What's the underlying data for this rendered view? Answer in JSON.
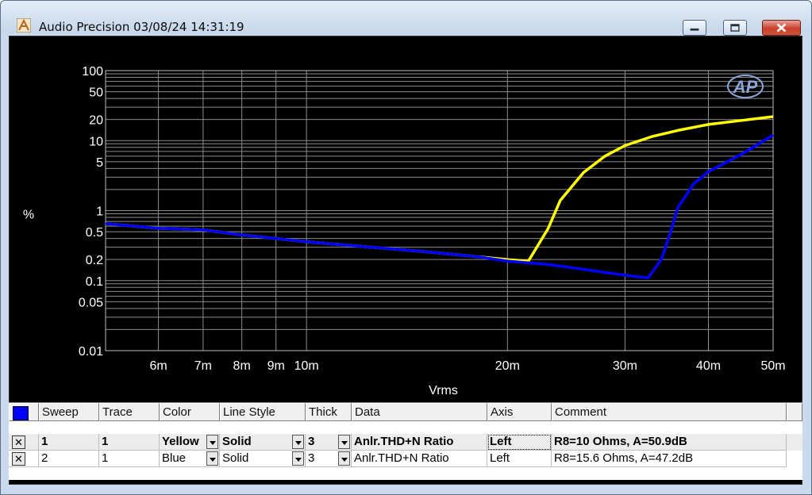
{
  "window": {
    "title": "Audio Precision  03/08/24 14:31:19",
    "app_icon": "audio-precision-icon",
    "buttons": [
      "minimize-icon",
      "maximize-icon",
      "close-icon"
    ]
  },
  "chart_data": {
    "type": "line",
    "xlabel": "Vrms",
    "ylabel": "%",
    "x_scale": "log",
    "y_scale": "log",
    "xlim": [
      0.005,
      0.05
    ],
    "ylim": [
      0.01,
      100
    ],
    "grid": true,
    "logo": "AP",
    "x_ticks": [
      {
        "label": "6m",
        "value": 0.006
      },
      {
        "label": "7m",
        "value": 0.007
      },
      {
        "label": "8m",
        "value": 0.008
      },
      {
        "label": "9m",
        "value": 0.009
      },
      {
        "label": "10m",
        "value": 0.01
      },
      {
        "label": "20m",
        "value": 0.02
      },
      {
        "label": "30m",
        "value": 0.03
      },
      {
        "label": "40m",
        "value": 0.04
      },
      {
        "label": "50m",
        "value": 0.05
      }
    ],
    "y_ticks": [
      {
        "label": "100",
        "value": 100
      },
      {
        "label": "50",
        "value": 50
      },
      {
        "label": "20",
        "value": 20
      },
      {
        "label": "10",
        "value": 10
      },
      {
        "label": "5",
        "value": 5
      },
      {
        "label": "1",
        "value": 1
      },
      {
        "label": "0.5",
        "value": 0.5
      },
      {
        "label": "0.2",
        "value": 0.2
      },
      {
        "label": "0.1",
        "value": 0.1
      },
      {
        "label": "0.05",
        "value": 0.05
      },
      {
        "label": "0.01",
        "value": 0.01
      }
    ],
    "series": [
      {
        "color": "#ffff00",
        "x": [
          0.005,
          0.006,
          0.007,
          0.008,
          0.01,
          0.012,
          0.015,
          0.018,
          0.02,
          0.0215,
          0.023,
          0.024,
          0.026,
          0.028,
          0.03,
          0.033,
          0.036,
          0.04,
          0.045,
          0.05
        ],
        "y": [
          0.65,
          0.56,
          0.53,
          0.45,
          0.36,
          0.31,
          0.26,
          0.22,
          0.2,
          0.19,
          0.55,
          1.4,
          3.5,
          6.0,
          8.5,
          11.5,
          14.0,
          17.0,
          19.5,
          22.0
        ]
      },
      {
        "color": "#0000ff",
        "x": [
          0.005,
          0.006,
          0.007,
          0.008,
          0.01,
          0.012,
          0.015,
          0.018,
          0.02,
          0.023,
          0.026,
          0.029,
          0.031,
          0.0325,
          0.034,
          0.035,
          0.036,
          0.038,
          0.04,
          0.045,
          0.05
        ],
        "y": [
          0.65,
          0.56,
          0.53,
          0.45,
          0.36,
          0.31,
          0.26,
          0.22,
          0.19,
          0.17,
          0.145,
          0.125,
          0.115,
          0.11,
          0.2,
          0.45,
          1.1,
          2.4,
          3.6,
          6.5,
          12.0
        ]
      }
    ]
  },
  "table": {
    "headers": [
      "Sweep",
      "Trace",
      "Color",
      "Line Style",
      "Thick",
      "Data",
      "Axis",
      "Comment"
    ],
    "rows": [
      {
        "delete": "x-icon",
        "sweep": "1",
        "trace": "1",
        "color": "Yellow",
        "line_style": "Solid",
        "thick": "3",
        "data": "Anlr.THD+N Ratio",
        "axis": "Left",
        "comment": "R8=10 Ohms, A=50.9dB"
      },
      {
        "delete": "x-icon",
        "sweep": "2",
        "trace": "1",
        "color": "Blue",
        "line_style": "Solid",
        "thick": "3",
        "data": "Anlr.THD+N Ratio",
        "axis": "Left",
        "comment": "R8=15.6 Ohms, A=47.2dB"
      }
    ]
  }
}
